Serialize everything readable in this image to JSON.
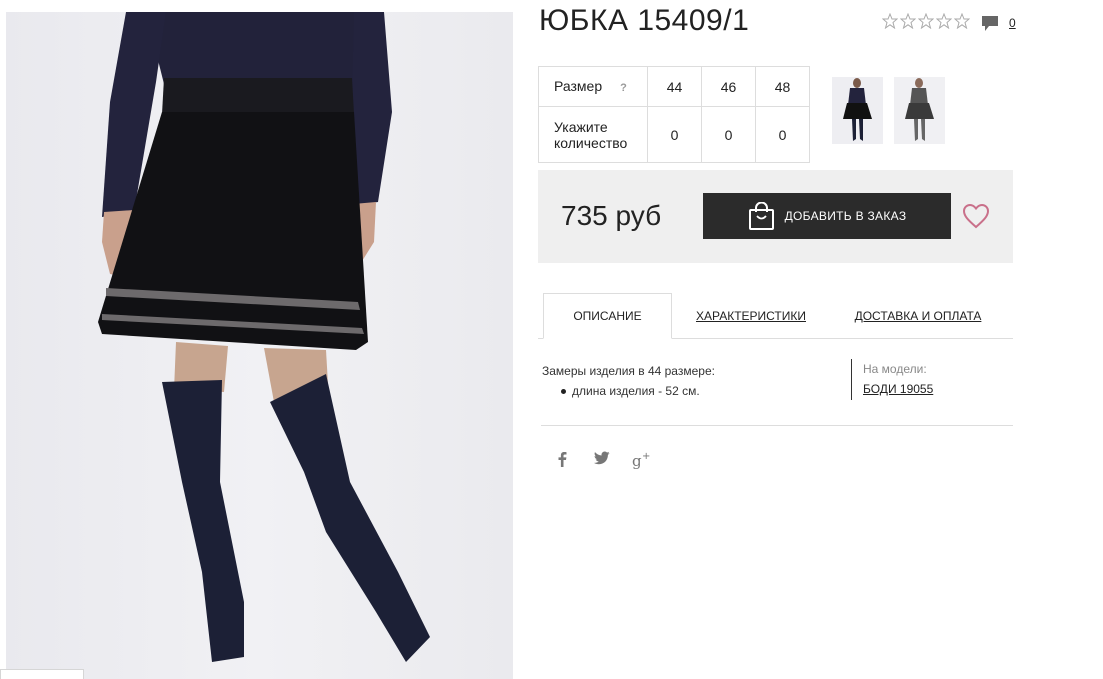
{
  "product": {
    "title": "ЮБКА 15409/1",
    "rating_stars": 5,
    "rating_value": 0,
    "comments_count": "0"
  },
  "sizes": {
    "size_label": "Размер",
    "help": "?",
    "qty_label_line1": "Укажите",
    "qty_label_line2": "количество",
    "values": [
      "44",
      "46",
      "48"
    ],
    "quantities": [
      "0",
      "0",
      "0"
    ]
  },
  "buy": {
    "price": "735 руб",
    "add_button": "ДОБАВИТЬ В ЗАКАЗ"
  },
  "tabs": {
    "description": "ОПИСАНИЕ",
    "characteristics": "ХАРАКТЕРИСТИКИ",
    "delivery": "ДОСТАВКА И ОПЛАТА"
  },
  "description": {
    "measure_title": "Замеры изделия в 44 размере:",
    "length": "длина изделия - 52 см."
  },
  "model": {
    "label": "На модели:",
    "link": "БОДИ 19055"
  },
  "social": {
    "facebook": "f",
    "googleplus": "g+"
  },
  "colors": {
    "button_bg": "#2b2b2b",
    "buy_box_bg": "#efefef",
    "heart": "#c9708a"
  }
}
